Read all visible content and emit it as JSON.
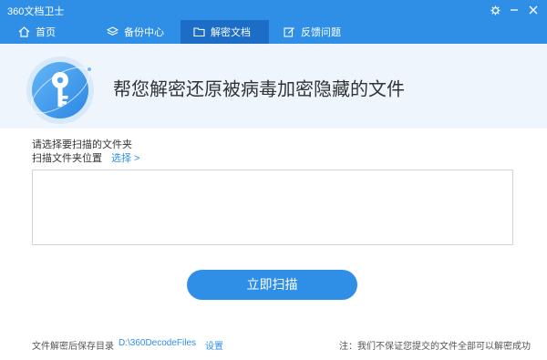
{
  "app": {
    "title": "360文档卫士"
  },
  "colors": {
    "accent": "#2f8fe7",
    "active_tab": "#1b6dc6",
    "banner_bg": "#eef5fd"
  },
  "window_controls": [
    "gear-icon",
    "minimize-icon",
    "close-icon"
  ],
  "nav": {
    "tabs": [
      {
        "label": "首页",
        "icon": "home-icon",
        "active": false
      },
      {
        "label": "备份中心",
        "icon": "layers-icon",
        "active": false
      },
      {
        "label": "解密文档",
        "icon": "folder-icon",
        "active": true
      },
      {
        "label": "反馈问题",
        "icon": "edit-icon",
        "active": false
      }
    ]
  },
  "banner": {
    "title": "帮您解密还原被病毒加密隐藏的文件",
    "art": "key-icon"
  },
  "scan": {
    "section_label": "请选择要扫描的文件夹",
    "location_label": "扫描文件夹位置",
    "select_link": "选择 >",
    "button_label": "立即扫描"
  },
  "footer": {
    "save_label": "文件解密后保存目录",
    "save_path": "D:\\360DecodeFiles",
    "settings_link": "设置",
    "notice": "注：我们不保证您提交的文件全部可以解密成功"
  }
}
